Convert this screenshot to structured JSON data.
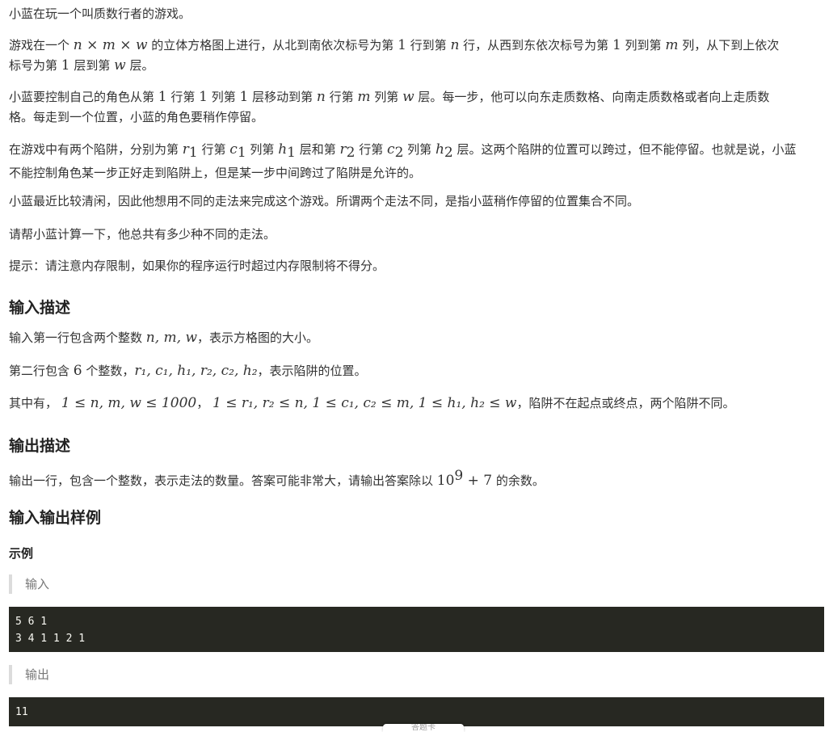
{
  "problem": {
    "p1": "小蓝在玩一个叫质数行者的游戏。",
    "p2_a": "游戏在一个 ",
    "p2_math1": "n × m × w",
    "p2_b": " 的立体方格图上进行，从北到南依次标号为第 ",
    "p2_one1": "1",
    "p2_c": " 行到第 ",
    "p2_n": "n",
    "p2_d": " 行，从西到东依次标号为第 ",
    "p2_one2": "1",
    "p2_e": " 列到第 ",
    "p2_m": "m",
    "p2_f": " 列，从下到上依次",
    "p2_g": "标号为第 ",
    "p2_one3": "1",
    "p2_h": " 层到第 ",
    "p2_w": "w",
    "p2_i": " 层。",
    "p3_a": "小蓝要控制自己的角色从第 ",
    "p3_1a": "1",
    "p3_b": " 行第 ",
    "p3_1b": "1",
    "p3_c": " 列第 ",
    "p3_1c": "1",
    "p3_d": " 层移动到第 ",
    "p3_n": "n",
    "p3_e": " 行第 ",
    "p3_m": "m",
    "p3_f": " 列第 ",
    "p3_w": "w",
    "p3_g": " 层。每一步，他可以向东走质数格、向南走质数格或者向上走质数",
    "p3_h": "格。每走到一个位置，小蓝的角色要稍作停留。",
    "p4_a": "在游戏中有两个陷阱，分别为第 ",
    "p4_b": " 行第 ",
    "p4_c": " 列第 ",
    "p4_d": " 层和第 ",
    "p4_e": " 行第 ",
    "p4_f": " 列第 ",
    "p4_g": " 层。这两个陷阱的位置可以跨过，但不能停留。也就是说，小蓝",
    "p4_h": "不能控制角色某一步正好走到陷阱上，但是某一步中间跨过了陷阱是允许的。",
    "p5": "小蓝最近比较清闲，因此他想用不同的走法来完成这个游戏。所谓两个走法不同，是指小蓝稍作停留的位置集合不同。",
    "p6": "请帮小蓝计算一下，他总共有多少种不同的走法。",
    "p7": "提示：请注意内存限制，如果你的程序运行时超过内存限制将不得分。"
  },
  "math": {
    "r": "r",
    "c": "c",
    "h": "h",
    "sub1": "1",
    "sub2": "2"
  },
  "input_desc": {
    "heading": "输入描述",
    "l1_a": "输入第一行包含两个整数 ",
    "l1_math": "n, m, w",
    "l1_b": "，表示方格图的大小。",
    "l2_a": "第二行包含 ",
    "l2_six": "6",
    "l2_b": " 个整数，",
    "l2_math": "r₁, c₁, h₁, r₂, c₂, h₂",
    "l2_c": "，表示陷阱的位置。",
    "l3_a": "其中有， ",
    "l3_math1": "1 ≤ n, m, w ≤ 1000",
    "l3_sep": "， ",
    "l3_math2": "1 ≤ r₁, r₂ ≤ n, 1 ≤ c₁, c₂ ≤ m, 1 ≤ h₁, h₂ ≤ w",
    "l3_b": "，陷阱不在起点或终点，两个陷阱不同。"
  },
  "output_desc": {
    "heading": "输出描述",
    "l1_a": "输出一行，包含一个整数，表示走法的数量。答案可能非常大，请输出答案除以 ",
    "l1_base": "10",
    "l1_exp": "9",
    "l1_plus": " + 7",
    "l1_b": " 的余数。"
  },
  "samples": {
    "heading": "输入输出样例",
    "example_label": "示例",
    "input_label": "输入",
    "input_code": "5 6 1\n3 4 1 1 2 1",
    "output_label": "输出",
    "output_code": "11"
  },
  "bottom_tab": {
    "label": "答题卡"
  }
}
